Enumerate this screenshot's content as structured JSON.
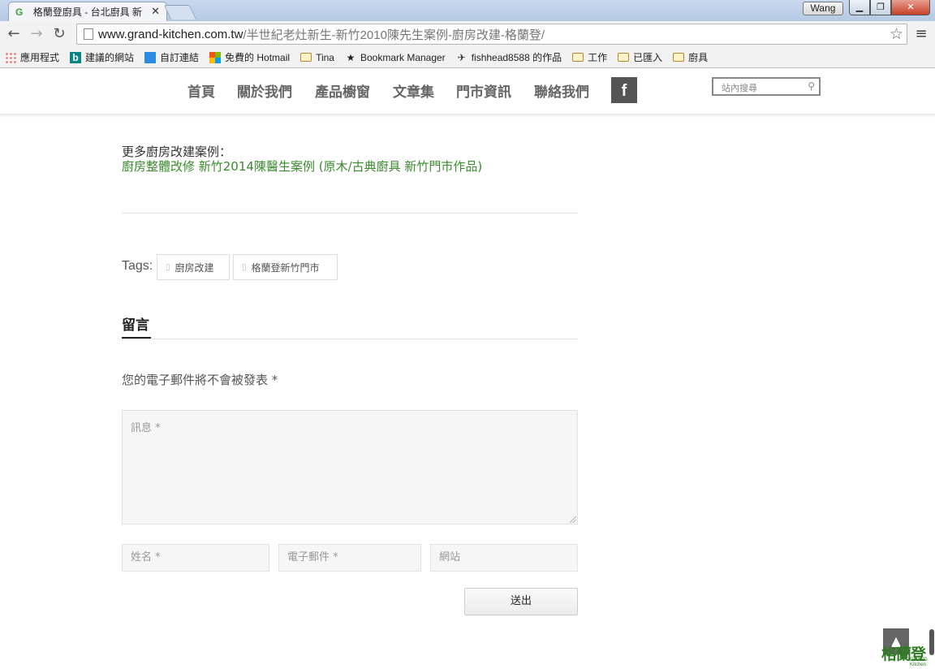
{
  "browser": {
    "tab_title": "格蘭登廚具 - 台北廚具 新",
    "tab_close": "✕",
    "profile": "Wang",
    "url_domain": "www.grand-kitchen.com.tw",
    "url_path": "/半世紀老灶新生-新竹2010陳先生案例-廚房改建-格蘭登/",
    "bookmarks": [
      {
        "label": "應用程式",
        "icon": "apps-icon"
      },
      {
        "label": "建議的網站",
        "icon": "bing-icon"
      },
      {
        "label": "自訂連結",
        "icon": "windows-icon"
      },
      {
        "label": "免費的 Hotmail",
        "icon": "microsoft-icon"
      },
      {
        "label": "Tina",
        "icon": "folder-icon"
      },
      {
        "label": "Bookmark Manager",
        "icon": "star-icon"
      },
      {
        "label": "fishhead8588 的作品",
        "icon": "fish-icon"
      },
      {
        "label": "工作",
        "icon": "folder-icon"
      },
      {
        "label": "已匯入",
        "icon": "folder-icon"
      },
      {
        "label": "廚具",
        "icon": "folder-icon"
      }
    ]
  },
  "site_nav": {
    "items": [
      "首頁",
      "關於我們",
      "產品櫥窗",
      "文章集",
      "門市資訊",
      "聯絡我們"
    ],
    "facebook": "f",
    "search_placeholder": "站內搜尋"
  },
  "content": {
    "more_label": "更多廚房改建案例：",
    "more_link": "廚房整體改修 新竹2014陳醫生案例 (原木/古典廚具 新竹門市作品)",
    "tags_label": "Tags:",
    "tags": [
      "廚房改建",
      "格蘭登新竹門市"
    ],
    "comment_heading": "留言",
    "email_note": "您的電子郵件將不會被發表 *"
  },
  "form": {
    "message_placeholder": "訊息  *",
    "name_placeholder": "姓名 *",
    "email_placeholder": "電子郵件 *",
    "website_placeholder": "網站",
    "submit_label": "送出"
  },
  "footer": {
    "scroll_top": "▲",
    "brand": "格蘭登",
    "brand_sub": "GRAND Kitchen"
  },
  "colors": {
    "link_green": "#3b8a2e",
    "nav_gray": "#666666"
  }
}
